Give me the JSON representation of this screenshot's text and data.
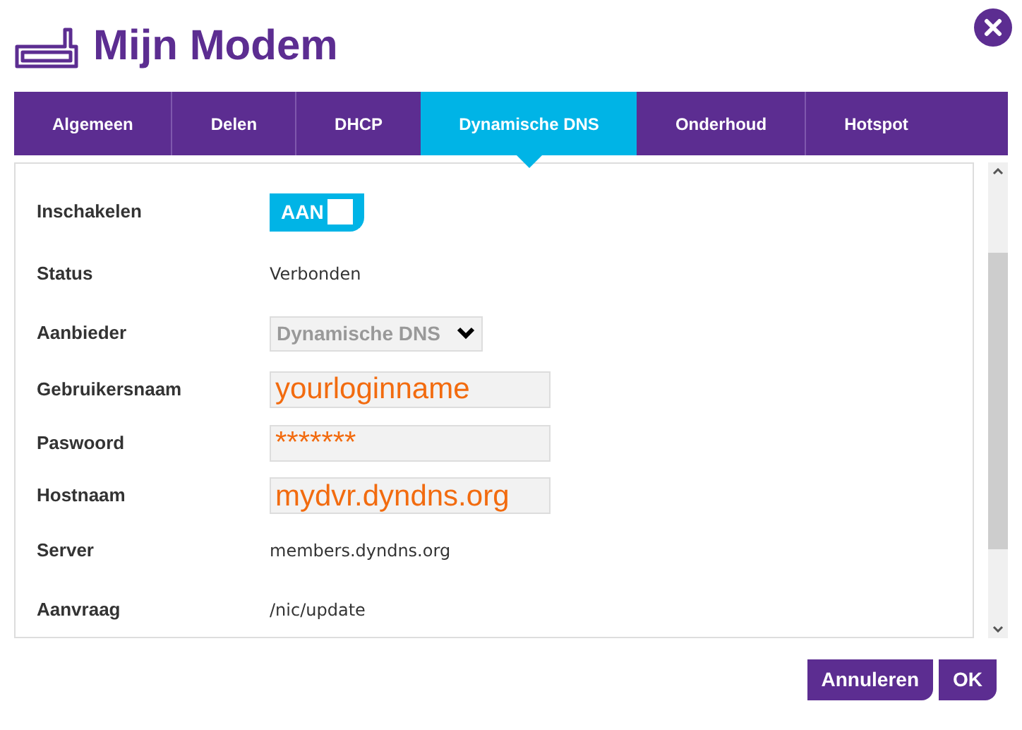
{
  "title": "Mijn Modem",
  "tabs": [
    {
      "label": "Algemeen",
      "selected": false
    },
    {
      "label": "Delen",
      "selected": false
    },
    {
      "label": "DHCP",
      "selected": false
    },
    {
      "label": "Dynamische DNS",
      "selected": true
    },
    {
      "label": "Onderhoud",
      "selected": false
    },
    {
      "label": "Hotspot",
      "selected": false
    }
  ],
  "fields": [
    {
      "kind": "toggle",
      "label": "Inschakelen",
      "on": true,
      "value": "AAN"
    },
    {
      "kind": "text",
      "label": "Status",
      "value": "Verbonden"
    },
    {
      "kind": "select",
      "label": "Aanbieder",
      "value": "Dynamische DNS"
    },
    {
      "kind": "input",
      "label": "Gebruikersnaam",
      "value": "yourloginname"
    },
    {
      "kind": "input",
      "label": "Paswoord",
      "value": "*******"
    },
    {
      "kind": "input",
      "label": "Hostnaam",
      "value": "mydvr.dyndns.org"
    },
    {
      "kind": "text",
      "label": "Server",
      "value": "members.dyndns.org"
    },
    {
      "kind": "text",
      "label": "Aanvraag",
      "value": "/nic/update"
    }
  ],
  "buttons": [
    "Annuleren",
    "OK"
  ]
}
